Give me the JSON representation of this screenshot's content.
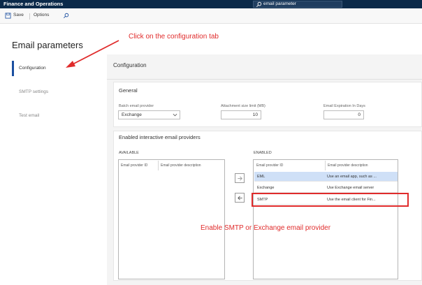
{
  "app": {
    "title": "Finance and Operations"
  },
  "search": {
    "value": "email parameter",
    "icon": "search-icon"
  },
  "toolbar": {
    "save_label": "Save",
    "options_label": "Options"
  },
  "page": {
    "title": "Email parameters"
  },
  "nav": {
    "items": [
      {
        "label": "Configuration",
        "selected": true
      },
      {
        "label": "SMTP settings",
        "selected": false
      },
      {
        "label": "Test email",
        "selected": false
      }
    ]
  },
  "main": {
    "section_title": "Configuration",
    "general": {
      "title": "General",
      "batch_provider": {
        "label": "Batch email provider",
        "value": "Exchange"
      },
      "attachment_size": {
        "label": "Attachment size limit (MB)",
        "value": "10"
      },
      "expiration": {
        "label": "Email Expiration In Days",
        "value": "0"
      }
    },
    "providers": {
      "title": "Enabled interactive email providers",
      "available": {
        "label": "AVAILABLE",
        "columns": [
          "Email provider ID",
          "Email provider description"
        ],
        "rows": []
      },
      "enabled": {
        "label": "ENABLED",
        "columns": [
          "Email provider ID",
          "Email provider description"
        ],
        "rows": [
          {
            "id": "EML",
            "description": "Use an email app, such as ...",
            "selected": true
          },
          {
            "id": "Exchange",
            "description": "Use Exchange email server",
            "selected": false
          },
          {
            "id": "SMTP",
            "description": "Use the email client for Fin...",
            "selected": false
          }
        ]
      }
    }
  },
  "annotations": {
    "click_tab": "Click on the configuration tab",
    "enable": "Enable SMTP or Exchange email provider",
    "color": "#e02b2b"
  },
  "colors": {
    "topbar": "#0b2a4a",
    "accent": "#1a4fa0",
    "selected_row": "#cfe0f7"
  }
}
